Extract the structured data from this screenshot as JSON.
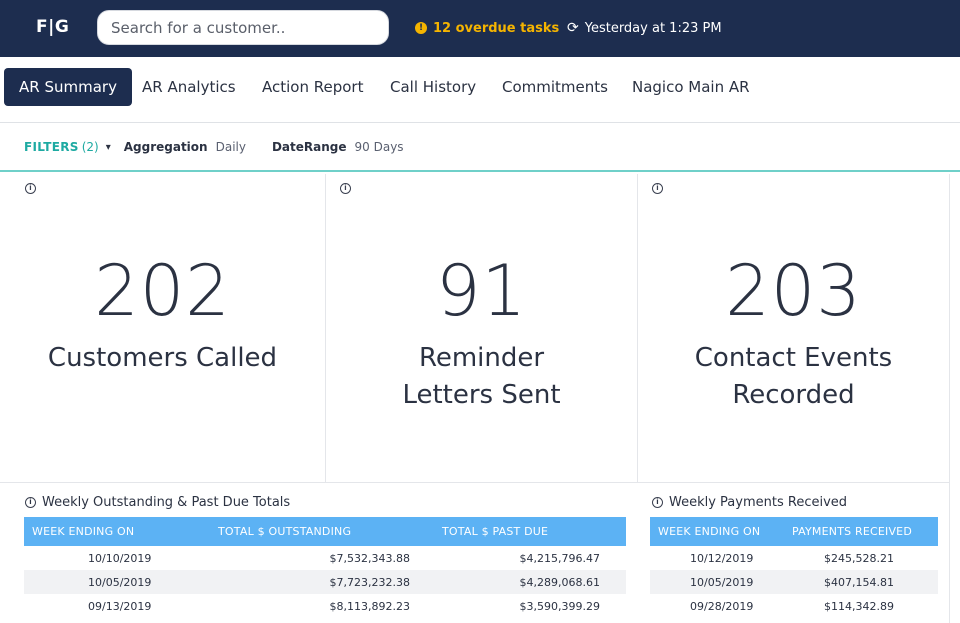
{
  "header": {
    "logo": "F|G",
    "search_placeholder": "Search for a customer..",
    "overdue_icon": "!",
    "overdue_text": "12 overdue tasks",
    "sync_icon": "⟳",
    "sync_text": "Yesterday at 1:23 PM"
  },
  "tabs": [
    {
      "label": "AR Summary",
      "active": true
    },
    {
      "label": "AR Analytics"
    },
    {
      "label": "Action Report"
    },
    {
      "label": "Call History"
    },
    {
      "label": "Commitments"
    },
    {
      "label": "Nagico Main AR"
    }
  ],
  "filters": {
    "label": "FILTERS",
    "count": "(2)",
    "caret": "▾",
    "aggregation_label": "Aggregation",
    "aggregation_value": "Daily",
    "daterange_label": "DateRange",
    "daterange_value": "90 Days"
  },
  "info_icon": "i",
  "kpis": [
    {
      "value": "202",
      "label": "Customers Called"
    },
    {
      "value": "91",
      "label": "Reminder Letters Sent"
    },
    {
      "value": "203",
      "label": "Contact Events Recorded"
    }
  ],
  "outstanding_table": {
    "title": "Weekly Outstanding & Past Due Totals",
    "headers": [
      "WEEK ENDING ON",
      "TOTAL $ OUTSTANDING",
      "TOTAL $ PAST DUE"
    ],
    "rows": [
      [
        "10/10/2019",
        "$7,532,343.88",
        "$4,215,796.47"
      ],
      [
        "10/05/2019",
        "$7,723,232.38",
        "$4,289,068.61"
      ],
      [
        "09/13/2019",
        "$8,113,892.23",
        "$3,590,399.29"
      ]
    ]
  },
  "payments_table": {
    "title": "Weekly Payments Received",
    "headers": [
      "WEEK ENDING ON",
      "PAYMENTS RECEIVED"
    ],
    "rows": [
      [
        "10/12/2019",
        "$245,528.21"
      ],
      [
        "10/05/2019",
        "$407,154.81"
      ],
      [
        "09/28/2019",
        "$114,342.89"
      ]
    ]
  },
  "colors": {
    "navy": "#1d2d4f",
    "warning": "#f5b400",
    "teal": "#1eaaa2",
    "table_header": "#5cb2f4"
  }
}
